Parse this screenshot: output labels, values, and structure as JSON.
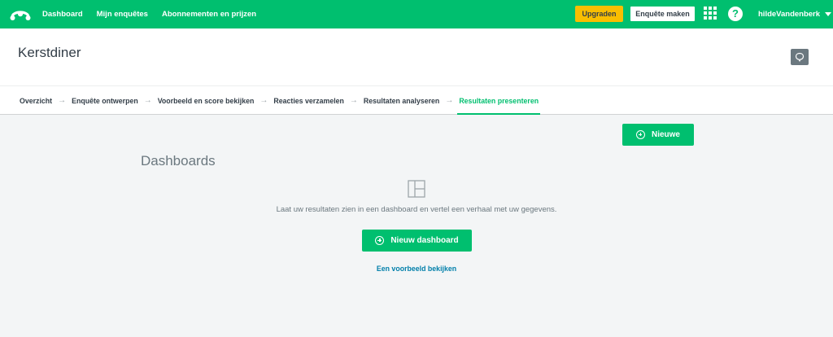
{
  "nav": {
    "links": [
      "Dashboard",
      "Mijn enquêtes",
      "Abonnementen en prijzen"
    ],
    "upgrade_label": "Upgraden",
    "create_label": "Enquête maken",
    "help_glyph": "?",
    "username": "hildeVandenberk",
    "brand_color": "#00bf6f"
  },
  "survey": {
    "title": "Kerstdiner"
  },
  "steps": [
    {
      "label": "Overzicht",
      "active": false
    },
    {
      "label": "Enquête ontwerpen",
      "active": false
    },
    {
      "label": "Voorbeeld en score bekijken",
      "active": false
    },
    {
      "label": "Reacties verzamelen",
      "active": false
    },
    {
      "label": "Resultaten analyseren",
      "active": false
    },
    {
      "label": "Resultaten presenteren",
      "active": true
    }
  ],
  "main": {
    "new_button_label": "Nieuwe",
    "heading": "Dashboards",
    "empty_message": "Laat uw resultaten zien in een dashboard en vertel een verhaal met uw gegevens.",
    "new_dashboard_label": "Nieuw dashboard",
    "example_link": "Een voorbeeld bekijken"
  },
  "icons": {
    "logo": "surveymonkey-logo-icon",
    "apps": "apps-grid-icon",
    "help": "help-icon",
    "comment": "comment-icon",
    "dashboard_layout": "dashboard-layout-icon",
    "add": "plus-circle-icon",
    "step_separator": "arrow-right-icon"
  }
}
